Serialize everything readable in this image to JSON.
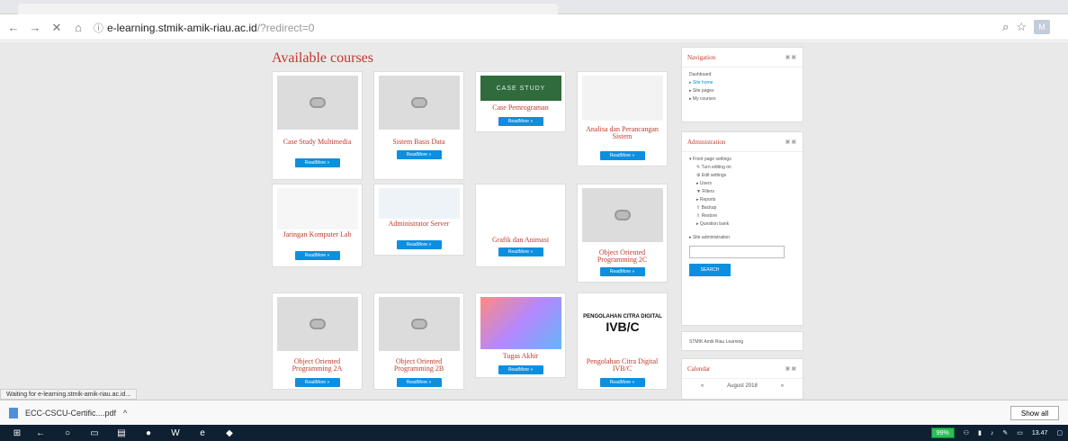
{
  "browser": {
    "url_host": "e-learning.stmik-amik-riau.ac.id",
    "url_path": "/?redirect=0",
    "status_text": "Waiting for e-learning.stmik-amik-riau.ac.id..."
  },
  "courses": {
    "title": "Available courses",
    "readmore_label": "ReadMore »",
    "items": [
      {
        "name": "Case Study Multimedia"
      },
      {
        "name": "Sistem Basis Data"
      },
      {
        "name": "Case Pemrograman",
        "thumb_text": "CASE STUDY"
      },
      {
        "name": "Analisa dan Perancangan Sistem"
      },
      {
        "name": "Jaringan Komputer Lab"
      },
      {
        "name": "Administrator Server"
      },
      {
        "name": "Grafik dan Animasi"
      },
      {
        "name": "Object Oriented Programming 2C"
      },
      {
        "name": "Object Oriented Programming 2A"
      },
      {
        "name": "Object Oriented Programming 2B"
      },
      {
        "name": "Tugas Akhir"
      },
      {
        "name": "Pengolahan Citra Digital IVB/C",
        "thumb_text": "PENGOLAHAN CITRA DIGITAL",
        "thumb_sub": "IVB/C"
      }
    ]
  },
  "navigation": {
    "title": "Navigation",
    "items": [
      "Dashboard",
      "Site home",
      "Site pages",
      "My courses"
    ]
  },
  "administration": {
    "title": "Administration",
    "items": [
      "Front page settings",
      "Turn editing on",
      "Edit settings",
      "Users",
      "Filters",
      "Reports",
      "Backup",
      "Restore",
      "Question bank",
      "Site administration"
    ],
    "search_button": "SEARCH"
  },
  "site_block": {
    "text": "STMIK Amik Riau Learning"
  },
  "calendar": {
    "title": "Calendar",
    "month": "August 2018"
  },
  "downloads": {
    "file": "ECC-CSCU-Certific....pdf",
    "show_all": "Show all"
  },
  "taskbar": {
    "battery": "99%",
    "time": "13.47"
  }
}
